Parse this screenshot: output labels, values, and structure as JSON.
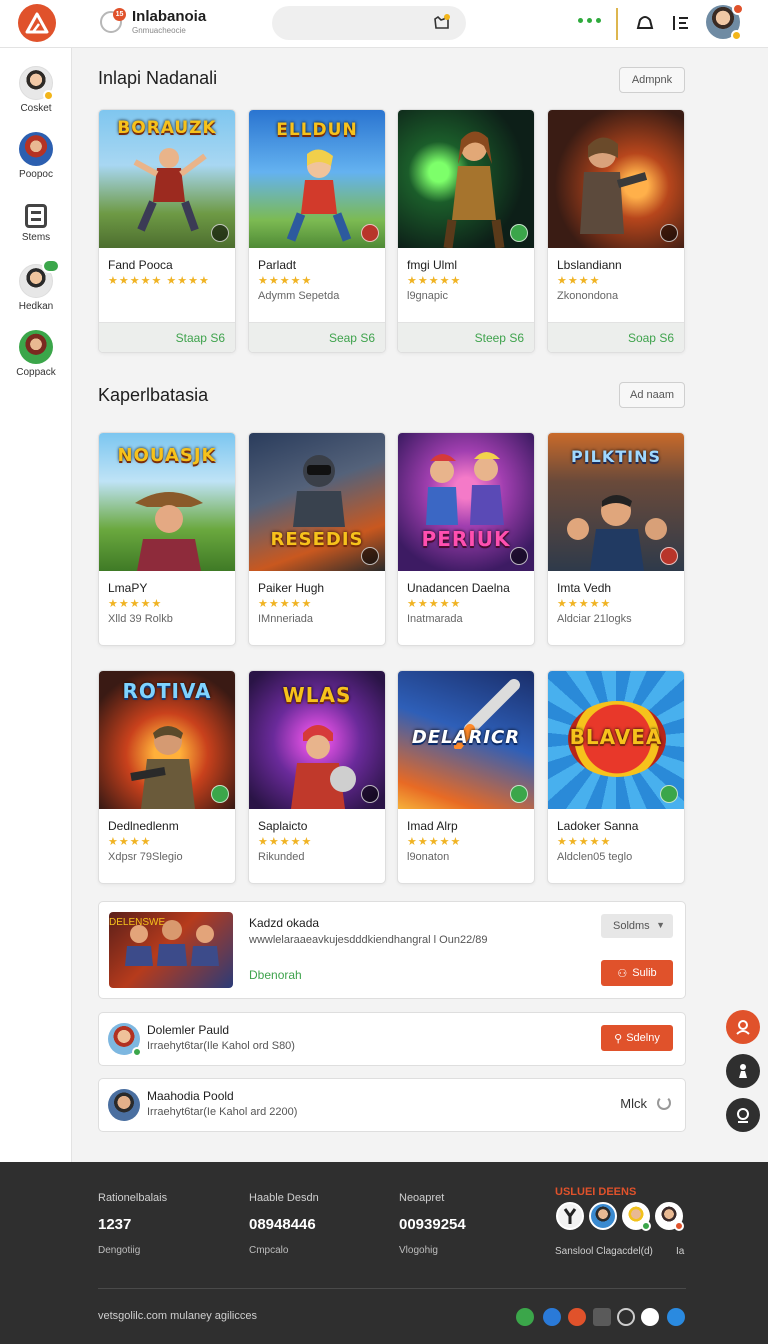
{
  "header": {
    "app_title": "Inlabanoia",
    "app_subtitle": "Gnmuacheocie",
    "notification_count": "15"
  },
  "sidebar": {
    "items": [
      {
        "label": "Cosket"
      },
      {
        "label": "Poopoc"
      },
      {
        "label": "Stems"
      },
      {
        "label": "Hedkan"
      },
      {
        "label": "Coppack"
      }
    ]
  },
  "section1": {
    "title": "Inlapi Nadanali",
    "action": "Admpnk",
    "cards": [
      {
        "thumb_text": "BORAUZK",
        "name": "Fand Pooca",
        "stars": "★★★★★ ★★★★",
        "meta": "",
        "footer": "Staap S6"
      },
      {
        "thumb_text": "ELLDUN",
        "name": "Parladt",
        "stars": "★★★★★",
        "meta": "Adymm Sepetda",
        "footer": "Seap S6"
      },
      {
        "thumb_text": "",
        "name": "fmgi Ulml",
        "stars": "★★★★★",
        "meta": "l9gnapic",
        "footer": "Steep S6"
      },
      {
        "thumb_text": "",
        "name": "Lbslandiann",
        "stars": "★★★★",
        "meta": "Zkonondona",
        "footer": "Soap S6"
      }
    ]
  },
  "section2": {
    "title": "Kaperlbatasia",
    "action": "Ad naam",
    "cards": [
      {
        "thumb_text": "NOUASJK",
        "name": "LmaPY",
        "stars": "★★★★★",
        "meta": "Xlld 39 Rolkb"
      },
      {
        "thumb_text": "RESEDIS",
        "name": "Paiker Hugh",
        "stars": "★★★★★",
        "meta": "IMnneriada"
      },
      {
        "thumb_text": "PERIUK",
        "name": "Unadancen Daelna",
        "stars": "★★★★★",
        "meta": "Inatmarada"
      },
      {
        "thumb_text": "PILKTINS",
        "name": "Imta Vedh",
        "stars": "★★★★★",
        "meta": "Aldciar 21logks"
      },
      {
        "thumb_text": "ROTIVA",
        "name": "Dedlnedlenm",
        "stars": "★★★★",
        "meta": "Xdpsr 79Slegio"
      },
      {
        "thumb_text": "WLAS",
        "name": "Saplaicto",
        "stars": "★★★★★",
        "meta": "Rikunded"
      },
      {
        "thumb_text": "DELARICR",
        "name": "Imad Alrp",
        "stars": "★★★★★",
        "meta": "l9onaton"
      },
      {
        "thumb_text": "BLAVEA",
        "name": "Ladoker Sanna",
        "stars": "★★★★★",
        "meta": "Aldclen05 teglo"
      }
    ]
  },
  "featured": {
    "thumb_text": "DELENSWE",
    "title": "Kadzd okada",
    "desc": "wwwlelaraaeavkujesdddkiendhangral l Oun22/89",
    "link": "Dbenorah",
    "select": "Soldms",
    "button": "Sulib"
  },
  "players": [
    {
      "name": "Dolemler Pauld",
      "desc": "Irraehyt6tar(Ile Kahol ord S80)",
      "button": "Sdelny"
    },
    {
      "name": "Maahodia Poold",
      "desc": "Irraehyt6tar(Ie Kahol ard 2200)",
      "status": "Mlck"
    }
  ],
  "footer": {
    "stats": [
      {
        "heading": "Rationelbalais",
        "value": "1237",
        "sub": "Dengotiig"
      },
      {
        "heading": "Haable Desdn",
        "value": "08948446",
        "sub": "Cmpcalo"
      },
      {
        "heading": "Neoapret",
        "value": "00939254",
        "sub": "Vlogohig"
      }
    ],
    "friends_title": "USLUEI DEENS",
    "friends_sub": "Sanslool Clagacdel(d)",
    "friends_sub_count": "Ia",
    "copyright": "vetsgolilc.com mulaney agilicces"
  },
  "colors": {
    "accent": "#e0522b",
    "green": "#3fa34d",
    "star": "#f0b323",
    "footer_bg": "#2f2f2f"
  }
}
